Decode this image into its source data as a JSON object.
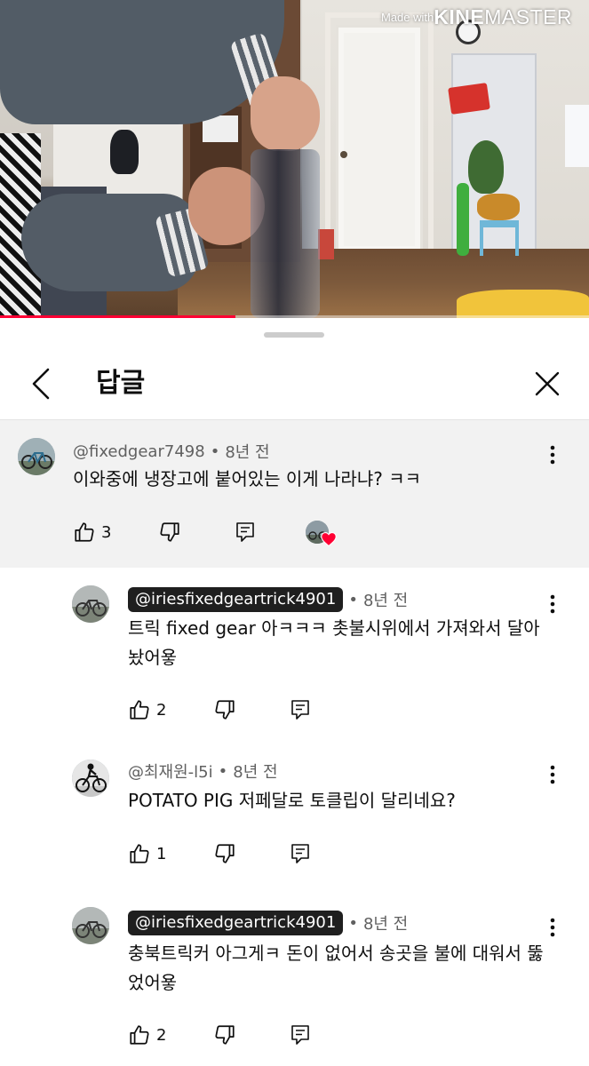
{
  "video": {
    "watermark_made_with": "Made with",
    "watermark_brand_bold": "KINE",
    "watermark_brand_rest": "MASTER",
    "progress_fraction": 0.4
  },
  "sheet": {
    "title": "답글"
  },
  "parent_comment": {
    "handle": "@fixedgear7498",
    "time": "8년 전",
    "text": "이와중에 냉장고에 붙어있는 이게 나라냐? ㅋㅋ",
    "likes": "3"
  },
  "replies": [
    {
      "handle": "@iriesfixedgeartrick4901",
      "time": "8년 전",
      "text": "트릭 fixed gear 아ㅋㅋㅋ 촛불시위에서 가져와서 달아놨어욯",
      "likes": "2"
    },
    {
      "handle": "@최재원-l5i",
      "time": "8년 전",
      "text": "POTATO PIG 저페달로 토클립이 달리네요?",
      "likes": "1"
    },
    {
      "handle": "@iriesfixedgeartrick4901",
      "time": "8년 전",
      "text": "충북트릭커 아그게ㅋ 돈이 없어서 송곳을 불에 대워서 뚫었어욯",
      "likes": "2"
    }
  ],
  "icons": {
    "back": "chevron-left-icon",
    "close": "close-icon",
    "like": "thumbs-up-icon",
    "dislike": "thumbs-down-icon",
    "reply": "reply-icon",
    "more": "more-vertical-icon",
    "creator_heart": "heart-icon"
  },
  "colors": {
    "progress": "#ff0033",
    "heart": "#ff0033",
    "highlight_bg": "#f2f2f2",
    "pill_bg": "#1f1f1f"
  }
}
